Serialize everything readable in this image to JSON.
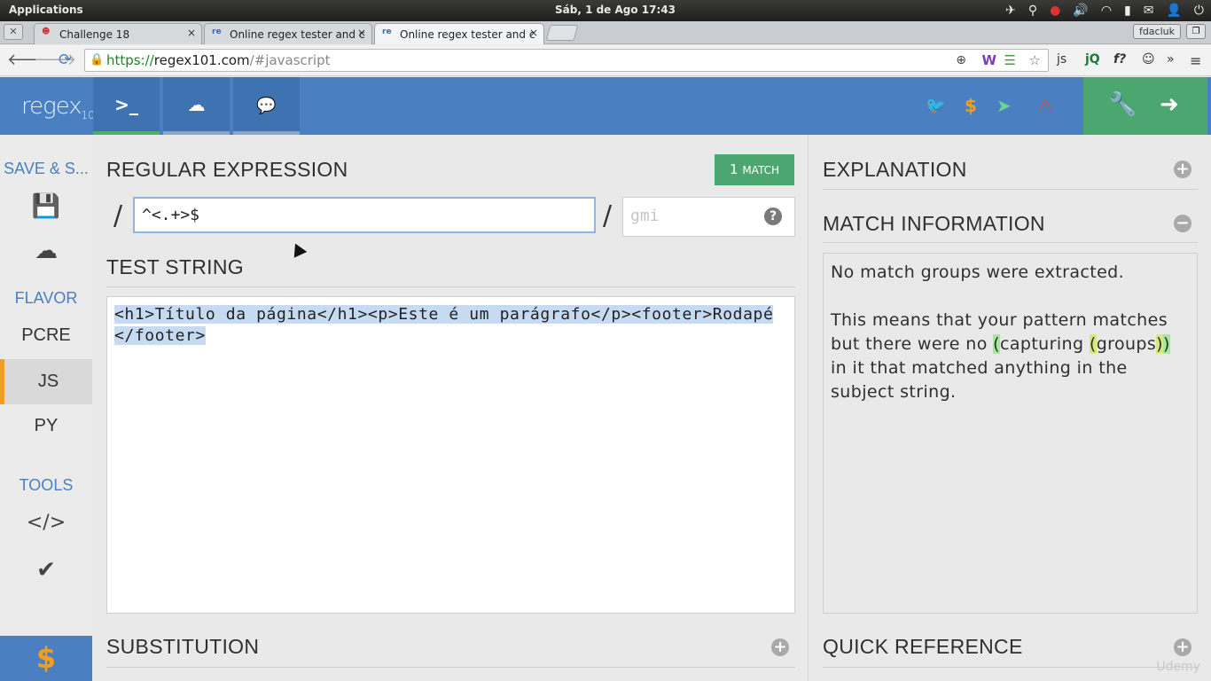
{
  "os": {
    "apps_label": "Applications",
    "clock": "Sáb,  1 de Ago 17:43",
    "user": "fdacluk"
  },
  "browser": {
    "tabs": [
      {
        "label": "Challenge 18",
        "icon": "user-avatar-icon"
      },
      {
        "label": "Online regex tester and c",
        "icon": "regex101-favicon"
      },
      {
        "label": "Online regex tester and c",
        "icon": "regex101-favicon"
      }
    ],
    "tab_close_glyph": "×",
    "favicon_text": "re",
    "url": {
      "scheme": "https://",
      "host": "regex101.com",
      "path": "/#javascript"
    }
  },
  "app": {
    "logo": "regex",
    "logo_sub": "101",
    "nav": [
      {
        "name": "terminal",
        "glyph": ">_"
      },
      {
        "name": "cloud",
        "glyph": "☁"
      },
      {
        "name": "chat",
        "glyph": "💬"
      }
    ]
  },
  "sidebar": {
    "save_heading": "SAVE & S...",
    "flavor_heading": "FLAVOR",
    "flavors": [
      "PCRE",
      "JS",
      "PY"
    ],
    "active_flavor": "JS",
    "tools_heading": "TOOLS",
    "donate": "$"
  },
  "editor": {
    "regex_title": "REGULAR EXPRESSION",
    "match_count": "1",
    "match_word": "MATCH",
    "delimiter": "/",
    "regex_value": "^<.+>$",
    "flags_placeholder": "gmi",
    "help_glyph": "?",
    "test_title": "TEST STRING",
    "test_string": "<h1>Título da página</h1><p>Este é um parágrafo</p><footer>Rodapé</footer>",
    "substitution_title": "SUBSTITUTION"
  },
  "panel": {
    "explanation_title": "EXPLANATION",
    "match_info_title": "MATCH INFORMATION",
    "match_info_line1": "No match groups were extracted.",
    "match_info_p2_a": "This means that your pattern matches but there were no ",
    "match_info_p2_b": "(",
    "match_info_p2_c": "capturing ",
    "match_info_p2_d": "(",
    "match_info_p2_e": "groups",
    "match_info_p2_f": ")",
    "match_info_p2_g": ")",
    "match_info_p2_h": " in it that matched anything in the subject string.",
    "quick_ref_title": "QUICK REFERENCE"
  },
  "watermark": "Udemy"
}
